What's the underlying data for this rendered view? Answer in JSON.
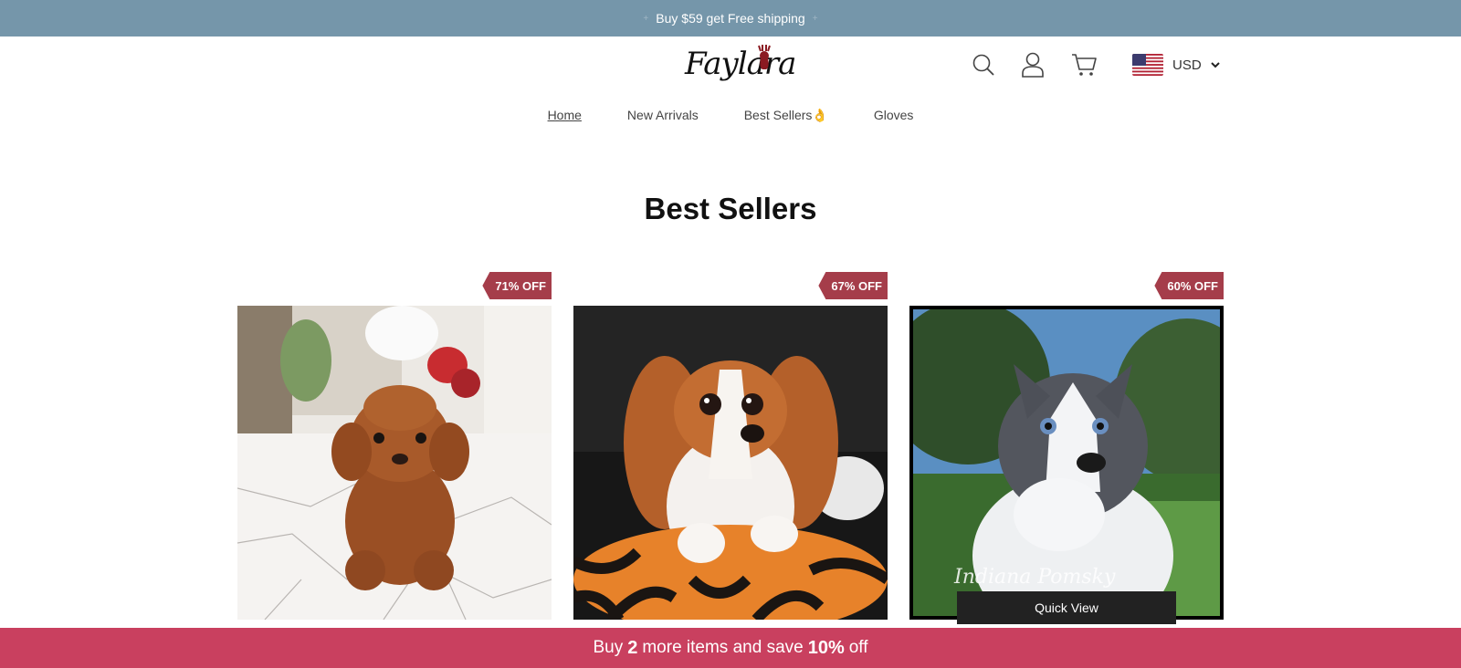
{
  "announcement": {
    "text": "Buy $59 get Free shipping",
    "deco": "+"
  },
  "header": {
    "logo_text": "Faylara",
    "currency": {
      "code": "USD",
      "flag": "us-flag-icon"
    },
    "icons": [
      "search-icon",
      "user-icon",
      "cart-icon"
    ]
  },
  "nav": {
    "items": [
      {
        "label": "Home",
        "active": true
      },
      {
        "label": "New Arrivals"
      },
      {
        "label": "Best Sellers👌"
      },
      {
        "label": "Gloves"
      }
    ]
  },
  "section": {
    "title": "Best Sellers"
  },
  "products": [
    {
      "badge": "71% OFF",
      "image": "brown-toy-poodle-puppy"
    },
    {
      "badge": "67% OFF",
      "image": "cavalier-king-charles-puppy"
    },
    {
      "badge": "60% OFF",
      "image": "husky-puppy",
      "signature": "Indiana Pomsky",
      "quick_view": "Quick View"
    }
  ],
  "promo_bar": {
    "pre": "Buy",
    "count": "2",
    "mid": "more items and save",
    "percent": "10%",
    "post": "off"
  },
  "colors": {
    "announce_bg": "#7596aa",
    "badge_bg": "#a53d4a",
    "promo_bg": "#c9405f"
  }
}
